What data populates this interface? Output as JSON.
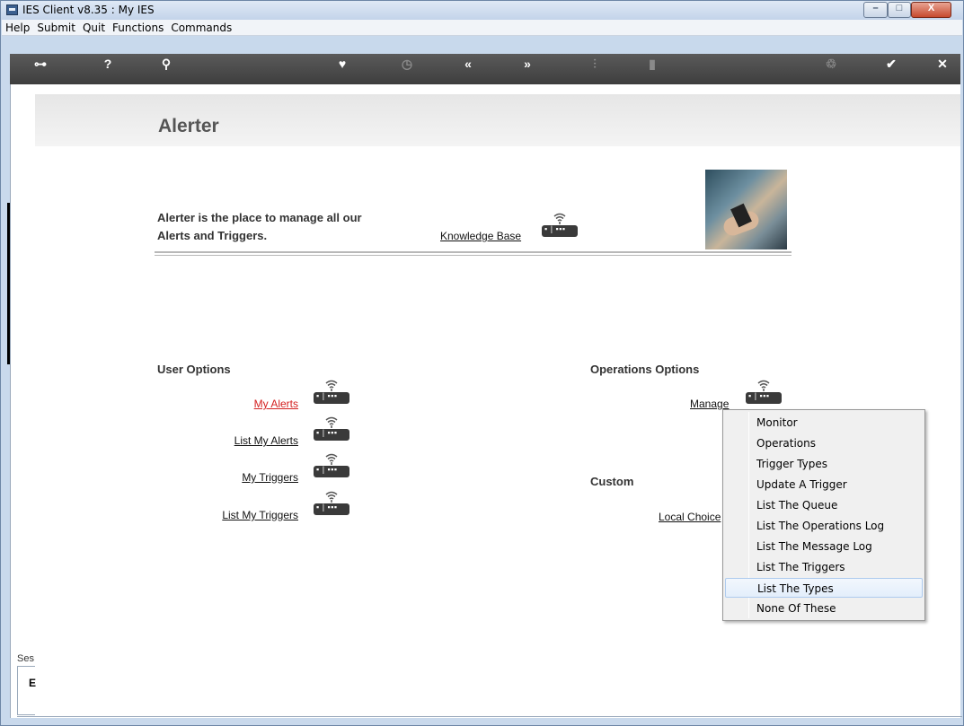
{
  "window": {
    "title": "IES Client v8.35 : My IES",
    "controls": {
      "minimize": "–",
      "maximize": "□",
      "close": "X"
    }
  },
  "menubar": {
    "items": [
      "Help",
      "Submit",
      "Quit",
      "Functions",
      "Commands"
    ]
  },
  "toolbar": {
    "icons": [
      {
        "name": "key-icon",
        "glyph": "⊶"
      },
      {
        "name": "help-icon",
        "glyph": "?"
      },
      {
        "name": "search-icon",
        "glyph": "⚲"
      },
      {
        "name": "heart-icon",
        "glyph": "♥"
      },
      {
        "name": "clock-icon",
        "glyph": "◷"
      },
      {
        "name": "back-icon",
        "glyph": "«"
      },
      {
        "name": "forward-icon",
        "glyph": "»"
      },
      {
        "name": "tools-icon",
        "glyph": "⫶"
      },
      {
        "name": "chip-icon",
        "glyph": "▮"
      },
      {
        "name": "recycle-icon",
        "glyph": "♲"
      },
      {
        "name": "check-icon",
        "glyph": "✔"
      },
      {
        "name": "close-icon",
        "glyph": "✕"
      }
    ]
  },
  "page": {
    "title": "Alerter",
    "intro_line1": "Alerter is the place to manage all our",
    "intro_line2": "Alerts and Triggers.",
    "knowledge_base": "Knowledge Base"
  },
  "user_options": {
    "title": "User Options",
    "items": [
      "My Alerts",
      "List My Alerts",
      "My Triggers",
      "List My Triggers"
    ]
  },
  "operations_options": {
    "title": "Operations Options",
    "manage": "Manage"
  },
  "custom": {
    "title": "Custom",
    "local_choices": "Local Choice"
  },
  "context_menu": {
    "items": [
      "Monitor",
      "Operations",
      "Trigger Types",
      "Update A Trigger",
      "List The Queue",
      "List The Operations Log",
      "List The Message Log",
      "List The Triggers",
      "List The Types",
      "None Of These"
    ],
    "highlighted": "List The Types"
  },
  "session": {
    "label": "Ses",
    "icon": "E"
  }
}
